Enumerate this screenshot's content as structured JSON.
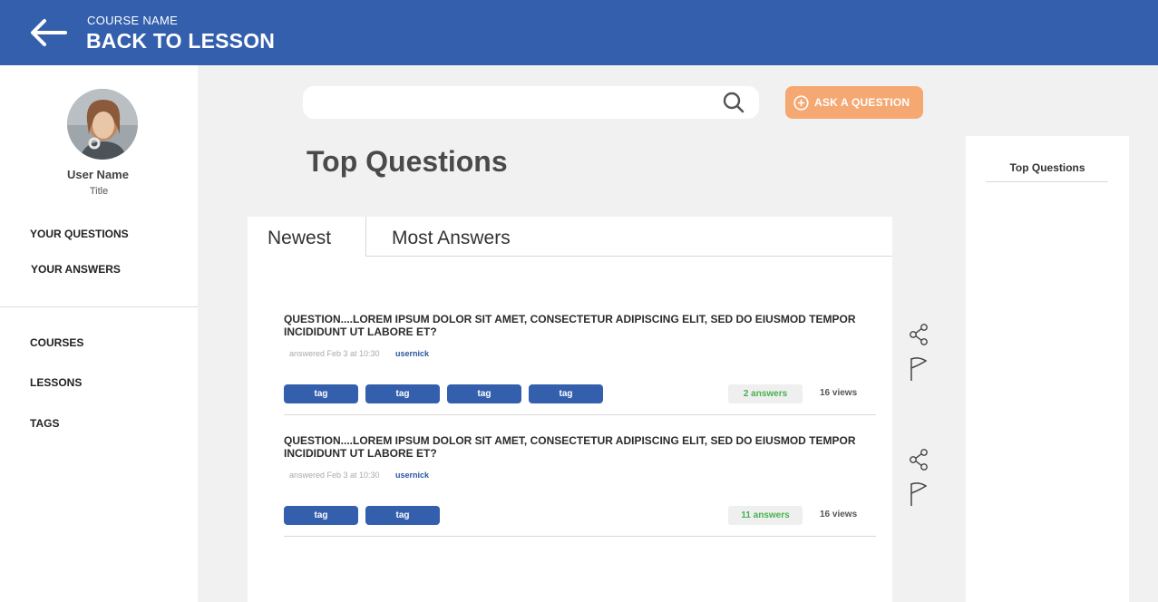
{
  "header": {
    "course_name": "COURSE NAME",
    "back_label": "BACK TO LESSON",
    "back_icon": "arrow-left-icon"
  },
  "sidebar": {
    "user_name": "User Name",
    "user_title": "Title",
    "links_top": [
      "YOUR QUESTIONS",
      "YOUR ANSWERS"
    ],
    "links_bottom": [
      "COURSES",
      "LESSONS",
      "TAGS"
    ]
  },
  "search": {
    "placeholder": "",
    "icon": "search-icon"
  },
  "ask_button": {
    "label": "ASK A QUESTION",
    "icon": "plus-circle-icon"
  },
  "page_title": "Top Questions",
  "tabs": [
    {
      "label": "Newest",
      "active": true
    },
    {
      "label": "Most Answers",
      "active": false
    }
  ],
  "questions": [
    {
      "title": "QUESTION....LOREM IPSUM DOLOR SIT AMET, CONSECTETUR ADIPISCING ELIT, SED DO EIUSMOD TEMPOR INCIDIDUNT UT LABORE ET?",
      "meta": "answered Feb 3 at 10:30",
      "user": "usernick",
      "tags": [
        "tag",
        "tag",
        "tag",
        "tag"
      ],
      "answers": "2 answers",
      "views": "16 views"
    },
    {
      "title": "QUESTION....LOREM IPSUM DOLOR SIT AMET, CONSECTETUR ADIPISCING ELIT, SED DO EIUSMOD TEMPOR INCIDIDUNT UT LABORE ET?",
      "meta": "answered Feb 3 at 10:30",
      "user": "usernick",
      "tags": [
        "tag",
        "tag"
      ],
      "answers": "11 answers",
      "views": "16 views"
    }
  ],
  "right_panel": {
    "title": "Top Questions"
  },
  "colors": {
    "header_bg": "#335fad",
    "accent": "#f5a872",
    "tag_bg": "#335fad",
    "answers_text": "#46b24d"
  }
}
